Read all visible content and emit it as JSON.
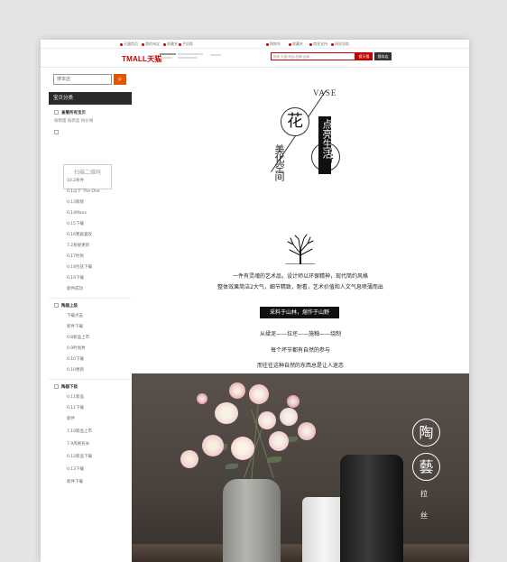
{
  "topbar": {
    "items": [
      "天猫首页",
      "我的淘宝",
      "收藏夹",
      "手机版",
      "购物车",
      "收藏夹",
      "商家支持",
      "网站导航"
    ]
  },
  "header": {
    "logo": "TMALL天猫",
    "search_placeholder": "搜索 天猫 商品/品牌/店铺",
    "search_button": "搜天猫",
    "shop_button": "搜本店"
  },
  "sidebar": {
    "search_placeholder": "搜本店",
    "search_icon": "search-icon",
    "category_header": "宝贝分类",
    "top_item": "查看所有宝贝",
    "sub_item": "按销量 按新品 按价格",
    "qr_label": "扫描二维码",
    "groups": [
      {
        "title": "",
        "items": [
          "10.2条件",
          "0.1以下 The One",
          "0.13新款",
          "0.14Maxx",
          "0.15下载",
          "0.16我就喜欢",
          "7.2系统更新",
          "0.17时尚",
          "0.18包括下载",
          "0.19下载",
          "新件成功"
        ]
      },
      {
        "title": "陶器上装",
        "items": [
          "下载点击",
          "新件下载",
          "0.8新品上市",
          "0.9时尚秀",
          "0.10下载",
          "0.10更新"
        ]
      },
      {
        "title": "陶器下装",
        "items": [
          "0.11新品",
          "0.11下载",
          "新件",
          "7.10新品上市",
          "7.9风格有米",
          "0.12新品下载",
          "0.13下载",
          "新件下载"
        ]
      }
    ]
  },
  "main": {
    "vase_label": "VASE",
    "title_char1": "花",
    "title_char2": "器",
    "subtitle_left": "美化空间",
    "subtitle_box": "点亮生活",
    "paragraph1": "一件有灵魂的艺术品，设计师以环保精神，现代简约风格",
    "paragraph2": "整体效果简洁2大气，细节精致，耐看，艺术价值和人文气息喷薄而出",
    "tag": "采料于山林，熔作于山野",
    "process": "从揉泥——拉坯——施釉——烧制",
    "line2": "每个坏节都有自然的参与",
    "line3": "而往往这种自然的东西总是让人迷恋",
    "photo_char1": "陶",
    "photo_char2": "藝",
    "photo_small1": "拉",
    "photo_small2": "丝"
  },
  "colors": {
    "brand_red": "#c40000",
    "search_orange": "#e05500",
    "dark": "#2a2a2a"
  }
}
